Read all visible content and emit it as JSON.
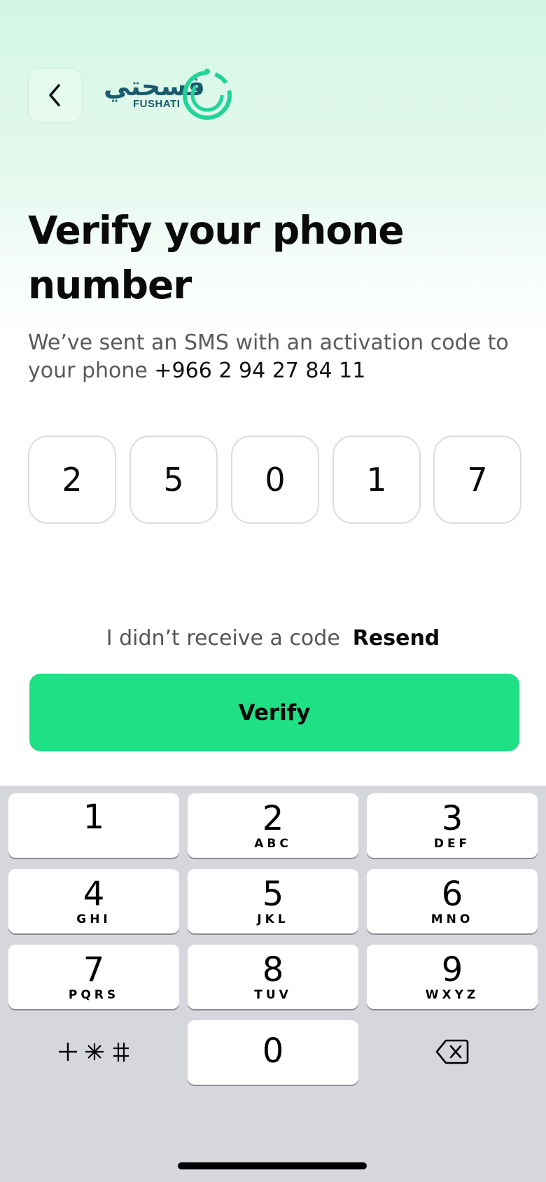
{
  "header": {
    "back_label": "back",
    "logo": {
      "arabic": "فسحتي",
      "latin": "FUSHATI"
    }
  },
  "main": {
    "title": "Verify your phone number",
    "subtitle_prefix": "We’ve sent an SMS with an activation code to your phone ",
    "phone_number": "+966 2 94 27 84 11",
    "otp_digits": [
      "2",
      "5",
      "0",
      "1",
      "7"
    ],
    "resend_prompt": "I didn’t receive a code",
    "resend_label": "Resend",
    "verify_label": "Verify"
  },
  "keyboard": {
    "keys": [
      {
        "digit": "1",
        "letters": ""
      },
      {
        "digit": "2",
        "letters": "ABC"
      },
      {
        "digit": "3",
        "letters": "DEF"
      },
      {
        "digit": "4",
        "letters": "GHI"
      },
      {
        "digit": "5",
        "letters": "JKL"
      },
      {
        "digit": "6",
        "letters": "MNO"
      },
      {
        "digit": "7",
        "letters": "PQRS"
      },
      {
        "digit": "8",
        "letters": "TUV"
      },
      {
        "digit": "9",
        "letters": "WXYZ"
      }
    ],
    "zero": "0",
    "symbols_label": "+*#",
    "delete_icon": "backspace-icon"
  },
  "colors": {
    "accent": "#1fe084",
    "logo_text": "#1b5b6e",
    "logo_ring": "#22d39a",
    "keyboard_bg": "#d5d7dd"
  }
}
